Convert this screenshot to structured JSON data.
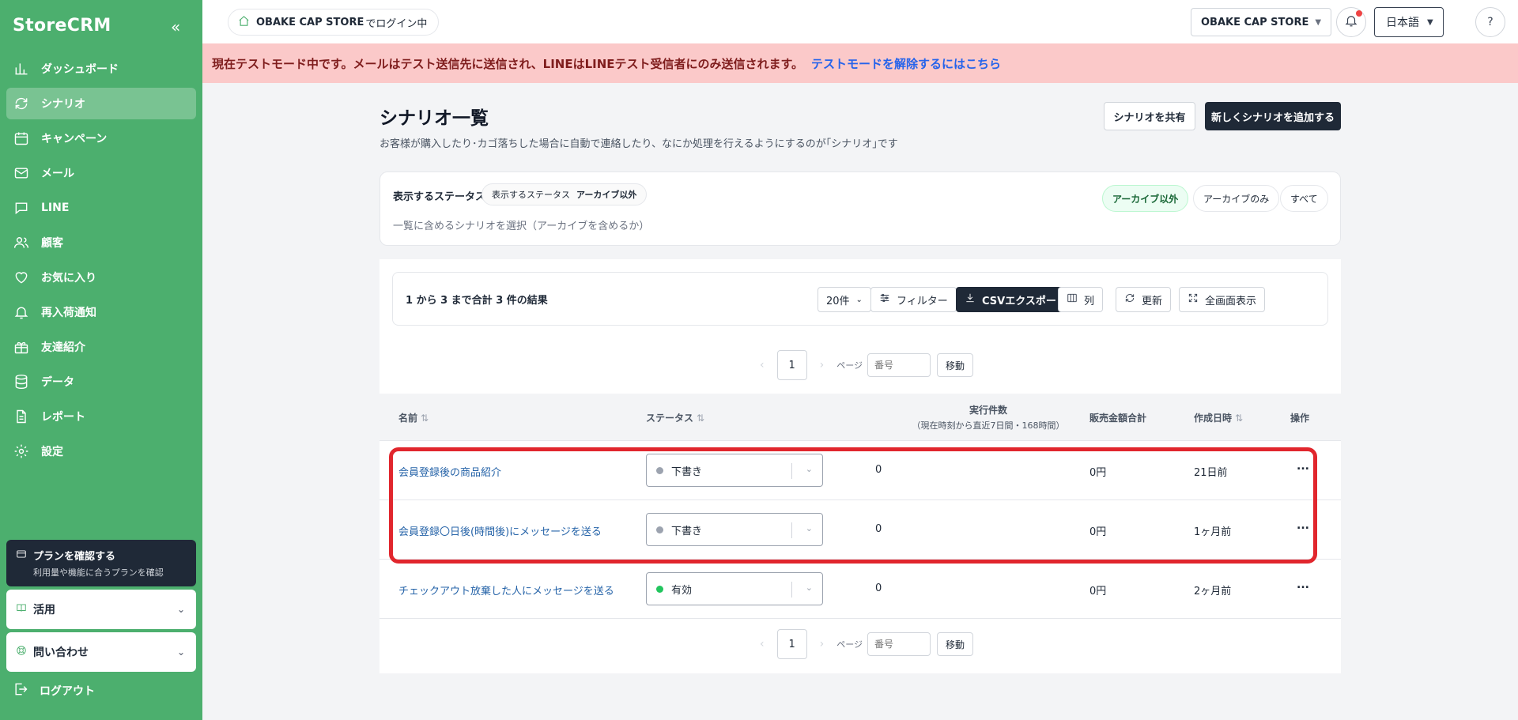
{
  "sidebar": {
    "logo": "StoreCRM",
    "collapse_icon": "«",
    "items": [
      {
        "label": "ダッシュボード",
        "icon": "chart-bars-icon",
        "active": false
      },
      {
        "label": "シナリオ",
        "icon": "sync-icon",
        "active": true
      },
      {
        "label": "キャンペーン",
        "icon": "calendar-icon",
        "active": false
      },
      {
        "label": "メール",
        "icon": "mail-icon",
        "active": false
      },
      {
        "label": "LINE",
        "icon": "chat-icon",
        "active": false
      },
      {
        "label": "顧客",
        "icon": "users-icon",
        "active": false
      },
      {
        "label": "お気に入り",
        "icon": "heart-icon",
        "active": false
      },
      {
        "label": "再入荷通知",
        "icon": "bell-icon",
        "active": false
      },
      {
        "label": "友達紹介",
        "icon": "gift-icon",
        "active": false
      },
      {
        "label": "データ",
        "icon": "database-icon",
        "active": false
      },
      {
        "label": "レポート",
        "icon": "document-icon",
        "active": false
      },
      {
        "label": "設定",
        "icon": "gear-icon",
        "active": false
      }
    ],
    "plan": {
      "title": "プランを確認する",
      "subtitle": "利用量や機能に合うプランを確認"
    },
    "usage": "活用",
    "contact": "問い合わせ",
    "logout": "ログアウト"
  },
  "topbar": {
    "store_name": "OBAKE CAP STORE",
    "store_suffix": "でログイン中",
    "store_select": "OBAKE CAP STORE",
    "language": "日本語",
    "help_glyph": "?"
  },
  "banner": {
    "text": "現在テストモード中です。メールはテスト送信先に送信され、LINEはLINEテスト受信者にのみ送信されます。",
    "link": "テストモードを解除するにはこちら"
  },
  "page": {
    "title": "シナリオ一覧",
    "subtitle": "お客様が購入したり･カゴ落ちした場合に自動で連絡したり、なにか処理を行えるようにするのが｢シナリオ｣です",
    "share_button": "シナリオを共有",
    "add_button": "新しくシナリオを追加する"
  },
  "filter": {
    "label": "表示するステータス",
    "chip_label": "表示するステータス",
    "chip_value": "アーカイブ以外",
    "description": "一覧に含めるシナリオを選択（アーカイブを含めるか）",
    "options": [
      "アーカイブ以外",
      "アーカイブのみ",
      "すべて"
    ],
    "selected": "アーカイブ以外"
  },
  "toolbar": {
    "result": "1 から 3 まで合計 3 件の結果",
    "per_page": "20件",
    "filter": "フィルター",
    "csv": "CSVエクスポート",
    "columns": "列",
    "refresh": "更新",
    "fullscreen": "全画面表示"
  },
  "pagination": {
    "current": "1",
    "page_label": "ページ",
    "input_placeholder": "番号",
    "go": "移動",
    "prev": "‹",
    "next": "›"
  },
  "table": {
    "headers": {
      "name": "名前",
      "status": "ステータス",
      "executions": "実行件数",
      "executions_sub": "（現在時刻から直近7日間・168時間）",
      "sales": "販売金額合計",
      "created": "作成日時",
      "actions": "操作"
    },
    "sort_glyph": "⇅",
    "rows": [
      {
        "name": "会員登録後の商品紹介",
        "status": "下書き",
        "status_color": "#9ca3af",
        "executions": "0",
        "sales": "0円",
        "created": "21日前",
        "actions": "..."
      },
      {
        "name": "会員登録〇日後(時間後)にメッセージを送る",
        "status": "下書き",
        "status_color": "#9ca3af",
        "executions": "0",
        "sales": "0円",
        "created": "1ヶ月前",
        "actions": "..."
      },
      {
        "name": "チェックアウト放棄した人にメッセージを送る",
        "status": "有効",
        "status_color": "#22c55e",
        "executions": "0",
        "sales": "0円",
        "created": "2ヶ月前",
        "actions": "..."
      }
    ]
  },
  "colors": {
    "sidebar": "#4caf6e",
    "banner": "#fbc9c9",
    "highlight": "#e1262d",
    "dark": "#1f2937"
  }
}
